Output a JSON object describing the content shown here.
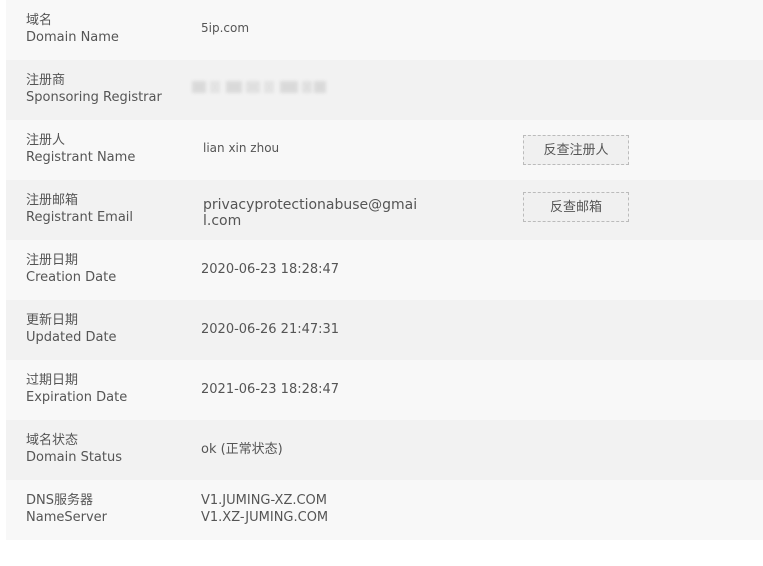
{
  "rows": [
    {
      "cn": "域名",
      "en": "Domain Name",
      "value": "5ip.com"
    },
    {
      "cn": "注册商",
      "en": "Sponsoring Registrar",
      "value": ""
    },
    {
      "cn": "注册人",
      "en": "Registrant Name",
      "value": "lian xin zhou",
      "button": "反查注册人"
    },
    {
      "cn": "注册邮箱",
      "en": "Registrant Email",
      "value": "privacyprotectionabuse@gmail.com",
      "button": "反查邮箱"
    },
    {
      "cn": "注册日期",
      "en": "Creation Date",
      "value": "2020-06-23 18:28:47"
    },
    {
      "cn": "更新日期",
      "en": "Updated Date",
      "value": "2020-06-26 21:47:31"
    },
    {
      "cn": "过期日期",
      "en": "Expiration Date",
      "value": "2021-06-23 18:28:47"
    },
    {
      "cn": "域名状态",
      "en": "Domain Status",
      "value": "ok (正常状态)"
    },
    {
      "cn": "DNS服务器",
      "en": "NameServer",
      "values": [
        "V1.JUMING-XZ.COM",
        "V1.XZ-JUMING.COM"
      ]
    }
  ]
}
